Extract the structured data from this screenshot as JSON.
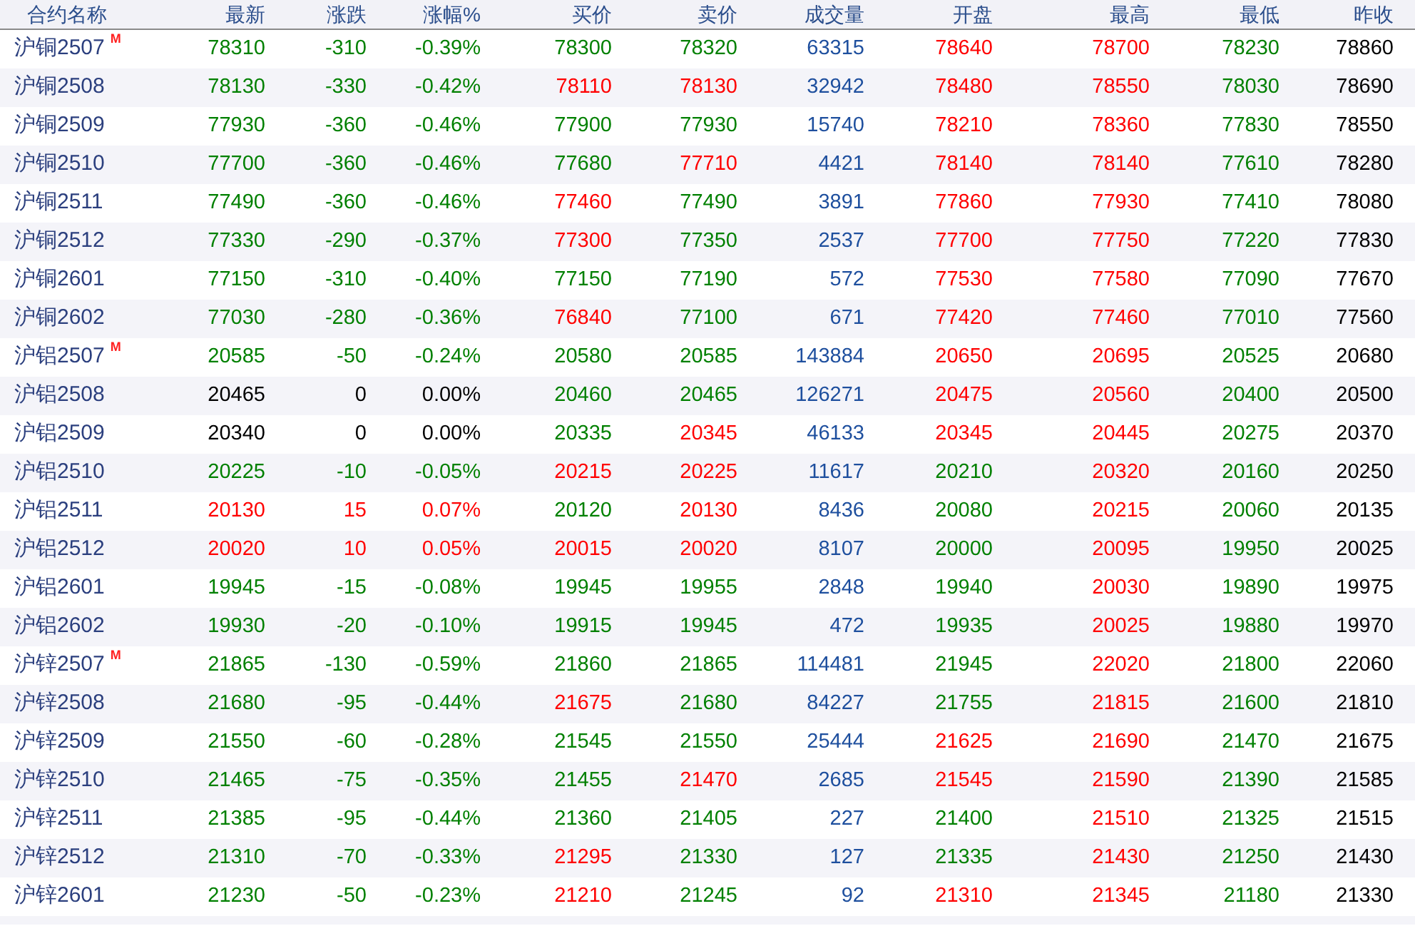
{
  "table": {
    "columns": [
      "合约名称",
      "最新",
      "涨跌",
      "涨幅%",
      "买价",
      "卖价",
      "成交量",
      "开盘",
      "最高",
      "最低",
      "昨收"
    ],
    "rows": [
      {
        "cells": [
          {
            "text": "沪铜2507",
            "mark": "M",
            "color": "#2b3f7e"
          },
          {
            "text": "78310",
            "color": "#008000"
          },
          {
            "text": "-310",
            "color": "#008000"
          },
          {
            "text": "-0.39%",
            "color": "#008000"
          },
          {
            "text": "78300",
            "color": "#008000"
          },
          {
            "text": "78320",
            "color": "#008000"
          },
          {
            "text": "63315",
            "color": "#1e4f9e"
          },
          {
            "text": "78640",
            "color": "#ff0000"
          },
          {
            "text": "78700",
            "color": "#ff0000"
          },
          {
            "text": "78230",
            "color": "#008000"
          },
          {
            "text": "78860",
            "color": "#000000"
          }
        ]
      },
      {
        "cells": [
          {
            "text": "沪铜2508",
            "color": "#2b3f7e"
          },
          {
            "text": "78130",
            "color": "#008000"
          },
          {
            "text": "-330",
            "color": "#008000"
          },
          {
            "text": "-0.42%",
            "color": "#008000"
          },
          {
            "text": "78110",
            "color": "#ff0000"
          },
          {
            "text": "78130",
            "color": "#ff0000"
          },
          {
            "text": "32942",
            "color": "#1e4f9e"
          },
          {
            "text": "78480",
            "color": "#ff0000"
          },
          {
            "text": "78550",
            "color": "#ff0000"
          },
          {
            "text": "78030",
            "color": "#008000"
          },
          {
            "text": "78690",
            "color": "#000000"
          }
        ]
      },
      {
        "cells": [
          {
            "text": "沪铜2509",
            "color": "#2b3f7e"
          },
          {
            "text": "77930",
            "color": "#008000"
          },
          {
            "text": "-360",
            "color": "#008000"
          },
          {
            "text": "-0.46%",
            "color": "#008000"
          },
          {
            "text": "77900",
            "color": "#008000"
          },
          {
            "text": "77930",
            "color": "#008000"
          },
          {
            "text": "15740",
            "color": "#1e4f9e"
          },
          {
            "text": "78210",
            "color": "#ff0000"
          },
          {
            "text": "78360",
            "color": "#ff0000"
          },
          {
            "text": "77830",
            "color": "#008000"
          },
          {
            "text": "78550",
            "color": "#000000"
          }
        ]
      },
      {
        "cells": [
          {
            "text": "沪铜2510",
            "color": "#2b3f7e"
          },
          {
            "text": "77700",
            "color": "#008000"
          },
          {
            "text": "-360",
            "color": "#008000"
          },
          {
            "text": "-0.46%",
            "color": "#008000"
          },
          {
            "text": "77680",
            "color": "#008000"
          },
          {
            "text": "77710",
            "color": "#ff0000"
          },
          {
            "text": "4421",
            "color": "#1e4f9e"
          },
          {
            "text": "78140",
            "color": "#ff0000"
          },
          {
            "text": "78140",
            "color": "#ff0000"
          },
          {
            "text": "77610",
            "color": "#008000"
          },
          {
            "text": "78280",
            "color": "#000000"
          }
        ]
      },
      {
        "cells": [
          {
            "text": "沪铜2511",
            "color": "#2b3f7e"
          },
          {
            "text": "77490",
            "color": "#008000"
          },
          {
            "text": "-360",
            "color": "#008000"
          },
          {
            "text": "-0.46%",
            "color": "#008000"
          },
          {
            "text": "77460",
            "color": "#ff0000"
          },
          {
            "text": "77490",
            "color": "#008000"
          },
          {
            "text": "3891",
            "color": "#1e4f9e"
          },
          {
            "text": "77860",
            "color": "#ff0000"
          },
          {
            "text": "77930",
            "color": "#ff0000"
          },
          {
            "text": "77410",
            "color": "#008000"
          },
          {
            "text": "78080",
            "color": "#000000"
          }
        ]
      },
      {
        "cells": [
          {
            "text": "沪铜2512",
            "color": "#2b3f7e"
          },
          {
            "text": "77330",
            "color": "#008000"
          },
          {
            "text": "-290",
            "color": "#008000"
          },
          {
            "text": "-0.37%",
            "color": "#008000"
          },
          {
            "text": "77300",
            "color": "#ff0000"
          },
          {
            "text": "77350",
            "color": "#008000"
          },
          {
            "text": "2537",
            "color": "#1e4f9e"
          },
          {
            "text": "77700",
            "color": "#ff0000"
          },
          {
            "text": "77750",
            "color": "#ff0000"
          },
          {
            "text": "77220",
            "color": "#008000"
          },
          {
            "text": "77830",
            "color": "#000000"
          }
        ]
      },
      {
        "cells": [
          {
            "text": "沪铜2601",
            "color": "#2b3f7e"
          },
          {
            "text": "77150",
            "color": "#008000"
          },
          {
            "text": "-310",
            "color": "#008000"
          },
          {
            "text": "-0.40%",
            "color": "#008000"
          },
          {
            "text": "77150",
            "color": "#008000"
          },
          {
            "text": "77190",
            "color": "#008000"
          },
          {
            "text": "572",
            "color": "#1e4f9e"
          },
          {
            "text": "77530",
            "color": "#ff0000"
          },
          {
            "text": "77580",
            "color": "#ff0000"
          },
          {
            "text": "77090",
            "color": "#008000"
          },
          {
            "text": "77670",
            "color": "#000000"
          }
        ]
      },
      {
        "cells": [
          {
            "text": "沪铜2602",
            "color": "#2b3f7e"
          },
          {
            "text": "77030",
            "color": "#008000"
          },
          {
            "text": "-280",
            "color": "#008000"
          },
          {
            "text": "-0.36%",
            "color": "#008000"
          },
          {
            "text": "76840",
            "color": "#ff0000"
          },
          {
            "text": "77100",
            "color": "#008000"
          },
          {
            "text": "671",
            "color": "#1e4f9e"
          },
          {
            "text": "77420",
            "color": "#ff0000"
          },
          {
            "text": "77460",
            "color": "#ff0000"
          },
          {
            "text": "77010",
            "color": "#008000"
          },
          {
            "text": "77560",
            "color": "#000000"
          }
        ]
      },
      {
        "cells": [
          {
            "text": "沪铝2507",
            "mark": "M",
            "color": "#2b3f7e"
          },
          {
            "text": "20585",
            "color": "#008000"
          },
          {
            "text": "-50",
            "color": "#008000"
          },
          {
            "text": "-0.24%",
            "color": "#008000"
          },
          {
            "text": "20580",
            "color": "#008000"
          },
          {
            "text": "20585",
            "color": "#008000"
          },
          {
            "text": "143884",
            "color": "#1e4f9e"
          },
          {
            "text": "20650",
            "color": "#ff0000"
          },
          {
            "text": "20695",
            "color": "#ff0000"
          },
          {
            "text": "20525",
            "color": "#008000"
          },
          {
            "text": "20680",
            "color": "#000000"
          }
        ]
      },
      {
        "cells": [
          {
            "text": "沪铝2508",
            "color": "#2b3f7e"
          },
          {
            "text": "20465",
            "color": "#000000"
          },
          {
            "text": "0",
            "color": "#000000"
          },
          {
            "text": "0.00%",
            "color": "#000000"
          },
          {
            "text": "20460",
            "color": "#008000"
          },
          {
            "text": "20465",
            "color": "#008000"
          },
          {
            "text": "126271",
            "color": "#1e4f9e"
          },
          {
            "text": "20475",
            "color": "#ff0000"
          },
          {
            "text": "20560",
            "color": "#ff0000"
          },
          {
            "text": "20400",
            "color": "#008000"
          },
          {
            "text": "20500",
            "color": "#000000"
          }
        ]
      },
      {
        "cells": [
          {
            "text": "沪铝2509",
            "color": "#2b3f7e"
          },
          {
            "text": "20340",
            "color": "#000000"
          },
          {
            "text": "0",
            "color": "#000000"
          },
          {
            "text": "0.00%",
            "color": "#000000"
          },
          {
            "text": "20335",
            "color": "#008000"
          },
          {
            "text": "20345",
            "color": "#ff0000"
          },
          {
            "text": "46133",
            "color": "#1e4f9e"
          },
          {
            "text": "20345",
            "color": "#ff0000"
          },
          {
            "text": "20445",
            "color": "#ff0000"
          },
          {
            "text": "20275",
            "color": "#008000"
          },
          {
            "text": "20370",
            "color": "#000000"
          }
        ]
      },
      {
        "cells": [
          {
            "text": "沪铝2510",
            "color": "#2b3f7e"
          },
          {
            "text": "20225",
            "color": "#008000"
          },
          {
            "text": "-10",
            "color": "#008000"
          },
          {
            "text": "-0.05%",
            "color": "#008000"
          },
          {
            "text": "20215",
            "color": "#ff0000"
          },
          {
            "text": "20225",
            "color": "#ff0000"
          },
          {
            "text": "11617",
            "color": "#1e4f9e"
          },
          {
            "text": "20210",
            "color": "#008000"
          },
          {
            "text": "20320",
            "color": "#ff0000"
          },
          {
            "text": "20160",
            "color": "#008000"
          },
          {
            "text": "20250",
            "color": "#000000"
          }
        ]
      },
      {
        "cells": [
          {
            "text": "沪铝2511",
            "color": "#2b3f7e"
          },
          {
            "text": "20130",
            "color": "#ff0000"
          },
          {
            "text": "15",
            "color": "#ff0000"
          },
          {
            "text": "0.07%",
            "color": "#ff0000"
          },
          {
            "text": "20120",
            "color": "#008000"
          },
          {
            "text": "20130",
            "color": "#ff0000"
          },
          {
            "text": "8436",
            "color": "#1e4f9e"
          },
          {
            "text": "20080",
            "color": "#008000"
          },
          {
            "text": "20215",
            "color": "#ff0000"
          },
          {
            "text": "20060",
            "color": "#008000"
          },
          {
            "text": "20135",
            "color": "#000000"
          }
        ]
      },
      {
        "cells": [
          {
            "text": "沪铝2512",
            "color": "#2b3f7e"
          },
          {
            "text": "20020",
            "color": "#ff0000"
          },
          {
            "text": "10",
            "color": "#ff0000"
          },
          {
            "text": "0.05%",
            "color": "#ff0000"
          },
          {
            "text": "20015",
            "color": "#ff0000"
          },
          {
            "text": "20020",
            "color": "#ff0000"
          },
          {
            "text": "8107",
            "color": "#1e4f9e"
          },
          {
            "text": "20000",
            "color": "#008000"
          },
          {
            "text": "20095",
            "color": "#ff0000"
          },
          {
            "text": "19950",
            "color": "#008000"
          },
          {
            "text": "20025",
            "color": "#000000"
          }
        ]
      },
      {
        "cells": [
          {
            "text": "沪铝2601",
            "color": "#2b3f7e"
          },
          {
            "text": "19945",
            "color": "#008000"
          },
          {
            "text": "-15",
            "color": "#008000"
          },
          {
            "text": "-0.08%",
            "color": "#008000"
          },
          {
            "text": "19945",
            "color": "#008000"
          },
          {
            "text": "19955",
            "color": "#008000"
          },
          {
            "text": "2848",
            "color": "#1e4f9e"
          },
          {
            "text": "19940",
            "color": "#008000"
          },
          {
            "text": "20030",
            "color": "#ff0000"
          },
          {
            "text": "19890",
            "color": "#008000"
          },
          {
            "text": "19975",
            "color": "#000000"
          }
        ]
      },
      {
        "cells": [
          {
            "text": "沪铝2602",
            "color": "#2b3f7e"
          },
          {
            "text": "19930",
            "color": "#008000"
          },
          {
            "text": "-20",
            "color": "#008000"
          },
          {
            "text": "-0.10%",
            "color": "#008000"
          },
          {
            "text": "19915",
            "color": "#008000"
          },
          {
            "text": "19945",
            "color": "#008000"
          },
          {
            "text": "472",
            "color": "#1e4f9e"
          },
          {
            "text": "19935",
            "color": "#008000"
          },
          {
            "text": "20025",
            "color": "#ff0000"
          },
          {
            "text": "19880",
            "color": "#008000"
          },
          {
            "text": "19970",
            "color": "#000000"
          }
        ]
      },
      {
        "cells": [
          {
            "text": "沪锌2507",
            "mark": "M",
            "color": "#2b3f7e"
          },
          {
            "text": "21865",
            "color": "#008000"
          },
          {
            "text": "-130",
            "color": "#008000"
          },
          {
            "text": "-0.59%",
            "color": "#008000"
          },
          {
            "text": "21860",
            "color": "#008000"
          },
          {
            "text": "21865",
            "color": "#008000"
          },
          {
            "text": "114481",
            "color": "#1e4f9e"
          },
          {
            "text": "21945",
            "color": "#008000"
          },
          {
            "text": "22020",
            "color": "#ff0000"
          },
          {
            "text": "21800",
            "color": "#008000"
          },
          {
            "text": "22060",
            "color": "#000000"
          }
        ]
      },
      {
        "cells": [
          {
            "text": "沪锌2508",
            "color": "#2b3f7e"
          },
          {
            "text": "21680",
            "color": "#008000"
          },
          {
            "text": "-95",
            "color": "#008000"
          },
          {
            "text": "-0.44%",
            "color": "#008000"
          },
          {
            "text": "21675",
            "color": "#ff0000"
          },
          {
            "text": "21680",
            "color": "#008000"
          },
          {
            "text": "84227",
            "color": "#1e4f9e"
          },
          {
            "text": "21755",
            "color": "#008000"
          },
          {
            "text": "21815",
            "color": "#ff0000"
          },
          {
            "text": "21600",
            "color": "#008000"
          },
          {
            "text": "21810",
            "color": "#000000"
          }
        ]
      },
      {
        "cells": [
          {
            "text": "沪锌2509",
            "color": "#2b3f7e"
          },
          {
            "text": "21550",
            "color": "#008000"
          },
          {
            "text": "-60",
            "color": "#008000"
          },
          {
            "text": "-0.28%",
            "color": "#008000"
          },
          {
            "text": "21545",
            "color": "#008000"
          },
          {
            "text": "21550",
            "color": "#008000"
          },
          {
            "text": "25444",
            "color": "#1e4f9e"
          },
          {
            "text": "21625",
            "color": "#ff0000"
          },
          {
            "text": "21690",
            "color": "#ff0000"
          },
          {
            "text": "21470",
            "color": "#008000"
          },
          {
            "text": "21675",
            "color": "#000000"
          }
        ]
      },
      {
        "cells": [
          {
            "text": "沪锌2510",
            "color": "#2b3f7e"
          },
          {
            "text": "21465",
            "color": "#008000"
          },
          {
            "text": "-75",
            "color": "#008000"
          },
          {
            "text": "-0.35%",
            "color": "#008000"
          },
          {
            "text": "21455",
            "color": "#008000"
          },
          {
            "text": "21470",
            "color": "#ff0000"
          },
          {
            "text": "2685",
            "color": "#1e4f9e"
          },
          {
            "text": "21545",
            "color": "#ff0000"
          },
          {
            "text": "21590",
            "color": "#ff0000"
          },
          {
            "text": "21390",
            "color": "#008000"
          },
          {
            "text": "21585",
            "color": "#000000"
          }
        ]
      },
      {
        "cells": [
          {
            "text": "沪锌2511",
            "color": "#2b3f7e"
          },
          {
            "text": "21385",
            "color": "#008000"
          },
          {
            "text": "-95",
            "color": "#008000"
          },
          {
            "text": "-0.44%",
            "color": "#008000"
          },
          {
            "text": "21360",
            "color": "#008000"
          },
          {
            "text": "21405",
            "color": "#008000"
          },
          {
            "text": "227",
            "color": "#1e4f9e"
          },
          {
            "text": "21400",
            "color": "#008000"
          },
          {
            "text": "21510",
            "color": "#ff0000"
          },
          {
            "text": "21325",
            "color": "#008000"
          },
          {
            "text": "21515",
            "color": "#000000"
          }
        ]
      },
      {
        "cells": [
          {
            "text": "沪锌2512",
            "color": "#2b3f7e"
          },
          {
            "text": "21310",
            "color": "#008000"
          },
          {
            "text": "-70",
            "color": "#008000"
          },
          {
            "text": "-0.33%",
            "color": "#008000"
          },
          {
            "text": "21295",
            "color": "#ff0000"
          },
          {
            "text": "21330",
            "color": "#008000"
          },
          {
            "text": "127",
            "color": "#1e4f9e"
          },
          {
            "text": "21335",
            "color": "#008000"
          },
          {
            "text": "21430",
            "color": "#ff0000"
          },
          {
            "text": "21250",
            "color": "#008000"
          },
          {
            "text": "21430",
            "color": "#000000"
          }
        ]
      },
      {
        "cells": [
          {
            "text": "沪锌2601",
            "color": "#2b3f7e"
          },
          {
            "text": "21230",
            "color": "#008000"
          },
          {
            "text": "-50",
            "color": "#008000"
          },
          {
            "text": "-0.23%",
            "color": "#008000"
          },
          {
            "text": "21210",
            "color": "#ff0000"
          },
          {
            "text": "21245",
            "color": "#008000"
          },
          {
            "text": "92",
            "color": "#1e4f9e"
          },
          {
            "text": "21310",
            "color": "#ff0000"
          },
          {
            "text": "21345",
            "color": "#ff0000"
          },
          {
            "text": "21180",
            "color": "#008000"
          },
          {
            "text": "21330",
            "color": "#000000"
          }
        ]
      }
    ]
  }
}
